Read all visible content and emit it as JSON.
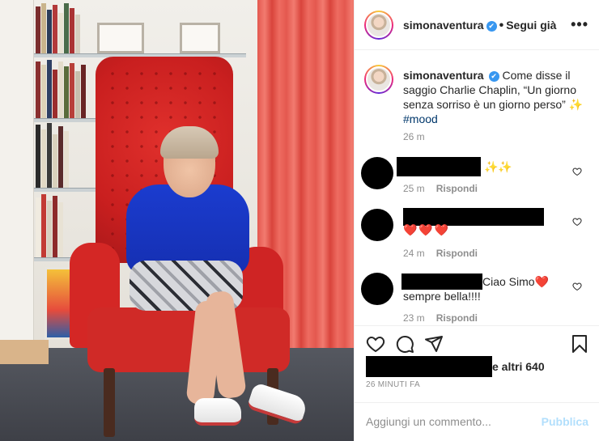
{
  "post": {
    "image_label": "photo-simona-ventura-red-chair"
  },
  "header": {
    "username": "simonaventura",
    "verified_icon": "✔",
    "separator": "•",
    "follow_label": "Segui già",
    "more_label": "•••"
  },
  "caption": {
    "username": "simonaventura",
    "text": "Come disse il saggio Charlie Chaplin, “Un giorno senza sorriso è un giorno perso”",
    "emoji": "✨",
    "hashtag": "#mood",
    "time": "26 m"
  },
  "comments": [
    {
      "text": "✨✨",
      "time": "25 m",
      "reply": "Rispondi"
    },
    {
      "text": "❤️❤️❤️",
      "time": "24 m",
      "reply": "Rispondi"
    },
    {
      "text_a": "Ciao Simo❤️",
      "text_b": "sempre bella!!!!",
      "time": "23 m",
      "reply": "Rispondi"
    }
  ],
  "likes": {
    "text": "e altri 640"
  },
  "time_ago": "26 MINUTI FA",
  "add_comment": {
    "placeholder": "Aggiungi un commento...",
    "publish": "Pubblica"
  },
  "colors": {
    "link": "#00376b",
    "verified": "#3897f0",
    "publish_disabled": "#b2dffc",
    "heart": "#e0262e"
  },
  "icons": [
    "heart-icon",
    "comment-icon",
    "share-icon",
    "bookmark-icon",
    "more-icon",
    "verified-icon"
  ]
}
